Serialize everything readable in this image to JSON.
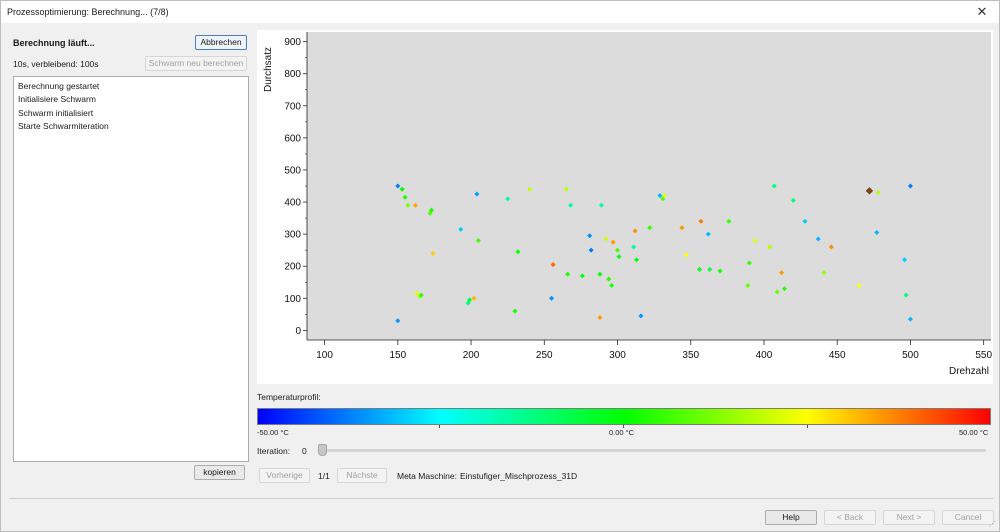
{
  "window": {
    "title": "Prozessoptimierung: Berechnung... (7/8)",
    "close_glyph": "✕"
  },
  "status": {
    "title": "Berechnung läuft...",
    "time": "10s, verbleibend: 100s"
  },
  "buttons": {
    "abort": "Abbrechen",
    "recalc": "Schwarm neu berechnen",
    "copy": "kopieren",
    "prev": "Vorherige",
    "next_page": "Nächste",
    "help": "Help",
    "back": "< Back",
    "next": "Next >",
    "cancel": "Cancel"
  },
  "log": [
    "Berechnung gestartet",
    "Initialisiere Schwarm",
    "Schwarm initialisiert",
    "Starte Schwarmiteration"
  ],
  "colorbar": {
    "label": "Temperaturprofil:",
    "min_label": "-50.00 °C",
    "mid_label": "0.00 °C",
    "max_label": "50.00 °C",
    "stops": [
      "#0000ff",
      "#00ffff",
      "#00ff00",
      "#ffff00",
      "#ff0000"
    ]
  },
  "iteration": {
    "label": "Iteration:",
    "value": "0",
    "slider_fraction": 0
  },
  "pagination": {
    "indicator": "1/1"
  },
  "machine": {
    "label": "Meta Maschine:",
    "value": "Einstufiger_Mischprozess_31D"
  },
  "chart_data": {
    "type": "scatter",
    "xlabel": "Drehzahl",
    "ylabel": "Durchsatz",
    "xlim": [
      88,
      555
    ],
    "ylim": [
      -30,
      930
    ],
    "xticks": [
      100,
      150,
      200,
      250,
      300,
      350,
      400,
      450,
      500,
      550
    ],
    "yticks": [
      0,
      100,
      200,
      300,
      400,
      500,
      600,
      700,
      800,
      900
    ],
    "grid": false,
    "background": "#dcdcdc",
    "color_scale": {
      "min": -50,
      "max": 50,
      "unit": "°C"
    },
    "points": [
      {
        "x": 150,
        "y": 30,
        "t": -35
      },
      {
        "x": 150,
        "y": 450,
        "t": -38
      },
      {
        "x": 153,
        "y": 440,
        "t": 0
      },
      {
        "x": 155,
        "y": 415,
        "t": 3
      },
      {
        "x": 157,
        "y": 390,
        "t": 12
      },
      {
        "x": 162,
        "y": 390,
        "t": 34
      },
      {
        "x": 163,
        "y": 115,
        "t": 22
      },
      {
        "x": 165,
        "y": 105,
        "t": 15
      },
      {
        "x": 166,
        "y": 110,
        "t": 5
      },
      {
        "x": 172,
        "y": 365,
        "t": 8
      },
      {
        "x": 173,
        "y": 375,
        "t": 2
      },
      {
        "x": 174,
        "y": 240,
        "t": 30
      },
      {
        "x": 193,
        "y": 315,
        "t": -30
      },
      {
        "x": 198,
        "y": 85,
        "t": -12
      },
      {
        "x": 199,
        "y": 95,
        "t": -6
      },
      {
        "x": 202,
        "y": 100,
        "t": 32
      },
      {
        "x": 204,
        "y": 425,
        "t": -34
      },
      {
        "x": 205,
        "y": 280,
        "t": 6
      },
      {
        "x": 225,
        "y": 410,
        "t": -15
      },
      {
        "x": 230,
        "y": 60,
        "t": 2
      },
      {
        "x": 232,
        "y": 245,
        "t": 1
      },
      {
        "x": 240,
        "y": 440,
        "t": 19
      },
      {
        "x": 255,
        "y": 100,
        "t": -36
      },
      {
        "x": 256,
        "y": 205,
        "t": 40
      },
      {
        "x": 265,
        "y": 440,
        "t": 18
      },
      {
        "x": 266,
        "y": 175,
        "t": 3
      },
      {
        "x": 268,
        "y": 390,
        "t": -15
      },
      {
        "x": 276,
        "y": 170,
        "t": -2
      },
      {
        "x": 281,
        "y": 295,
        "t": -36
      },
      {
        "x": 282,
        "y": 250,
        "t": -38
      },
      {
        "x": 288,
        "y": 40,
        "t": 35
      },
      {
        "x": 288,
        "y": 175,
        "t": -2
      },
      {
        "x": 289,
        "y": 390,
        "t": -15
      },
      {
        "x": 292,
        "y": 285,
        "t": 20
      },
      {
        "x": 294,
        "y": 160,
        "t": 3
      },
      {
        "x": 296,
        "y": 140,
        "t": 2
      },
      {
        "x": 297,
        "y": 275,
        "t": 35
      },
      {
        "x": 300,
        "y": 250,
        "t": 6
      },
      {
        "x": 301,
        "y": 230,
        "t": -2
      },
      {
        "x": 311,
        "y": 260,
        "t": -15
      },
      {
        "x": 312,
        "y": 310,
        "t": 36
      },
      {
        "x": 313,
        "y": 220,
        "t": -2
      },
      {
        "x": 316,
        "y": 45,
        "t": -35
      },
      {
        "x": 322,
        "y": 320,
        "t": 5
      },
      {
        "x": 329,
        "y": 420,
        "t": -32
      },
      {
        "x": 331,
        "y": 410,
        "t": 8
      },
      {
        "x": 332,
        "y": 420,
        "t": 22
      },
      {
        "x": 344,
        "y": 320,
        "t": 35
      },
      {
        "x": 347,
        "y": 235,
        "t": 25
      },
      {
        "x": 356,
        "y": 190,
        "t": -2
      },
      {
        "x": 357,
        "y": 340,
        "t": 38
      },
      {
        "x": 362,
        "y": 300,
        "t": -32
      },
      {
        "x": 363,
        "y": 190,
        "t": -6
      },
      {
        "x": 370,
        "y": 185,
        "t": 2
      },
      {
        "x": 376,
        "y": 340,
        "t": 5
      },
      {
        "x": 389,
        "y": 140,
        "t": 10
      },
      {
        "x": 390,
        "y": 210,
        "t": 5
      },
      {
        "x": 394,
        "y": 280,
        "t": 22
      },
      {
        "x": 404,
        "y": 260,
        "t": 18
      },
      {
        "x": 407,
        "y": 450,
        "t": -12
      },
      {
        "x": 409,
        "y": 120,
        "t": 10
      },
      {
        "x": 412,
        "y": 180,
        "t": 35
      },
      {
        "x": 414,
        "y": 130,
        "t": 3
      },
      {
        "x": 420,
        "y": 405,
        "t": -12
      },
      {
        "x": 428,
        "y": 340,
        "t": -30
      },
      {
        "x": 437,
        "y": 285,
        "t": -32
      },
      {
        "x": 441,
        "y": 180,
        "t": 14
      },
      {
        "x": 446,
        "y": 260,
        "t": 36
      },
      {
        "x": 465,
        "y": 140,
        "t": 25
      },
      {
        "x": 472,
        "y": 435,
        "t": 40
      },
      {
        "x": 477,
        "y": 305,
        "t": -32
      },
      {
        "x": 478,
        "y": 430,
        "t": 18
      },
      {
        "x": 496,
        "y": 220,
        "t": -30
      },
      {
        "x": 497,
        "y": 110,
        "t": -12
      },
      {
        "x": 500,
        "y": 450,
        "t": -38
      },
      {
        "x": 500,
        "y": 35,
        "t": -32
      }
    ],
    "highlight": {
      "x": 472,
      "y": 435,
      "color": "#8b4513"
    }
  }
}
